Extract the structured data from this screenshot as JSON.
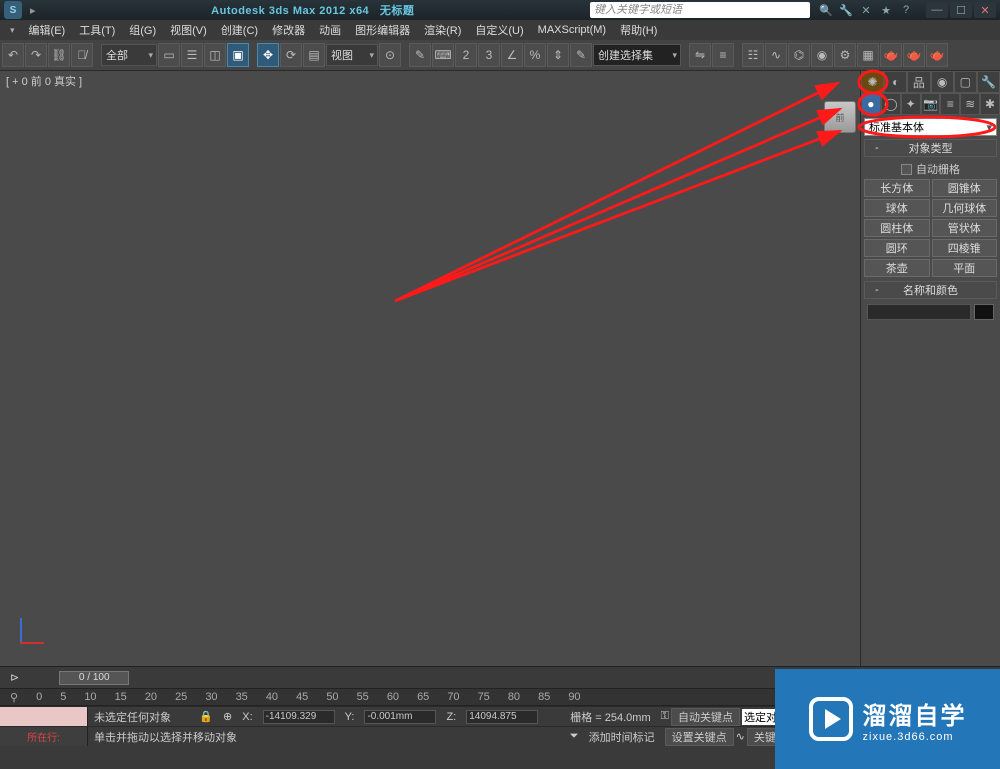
{
  "title": {
    "app": "Autodesk 3ds Max  2012  x64",
    "doc": "无标题",
    "search_placeholder": "键入关键字或短语",
    "app_icon": "S"
  },
  "menu": [
    "编辑(E)",
    "工具(T)",
    "组(G)",
    "视图(V)",
    "创建(C)",
    "修改器",
    "动画",
    "图形编辑器",
    "渲染(R)",
    "自定义(U)",
    "MAXScript(M)",
    "帮助(H)"
  ],
  "toolbar": {
    "filter_all": "全部",
    "view_label": "视图",
    "named_set_empty": "创建选择集"
  },
  "viewport": {
    "label": "[ + 0 前 0 真实 ]",
    "cube": "前"
  },
  "cmd": {
    "category": "标准基本体",
    "rollout_type": "对象类型",
    "autogrid": "自动栅格",
    "buttons": [
      [
        "长方体",
        "圆锥体"
      ],
      [
        "球体",
        "几何球体"
      ],
      [
        "圆柱体",
        "管状体"
      ],
      [
        "圆环",
        "四棱锥"
      ],
      [
        "茶壶",
        "平面"
      ]
    ],
    "rollout_name": "名称和颜色"
  },
  "time": {
    "range": "0 / 100",
    "ticks": [
      "0",
      "5",
      "10",
      "15",
      "20",
      "25",
      "30",
      "35",
      "40",
      "45",
      "50",
      "55",
      "60",
      "65",
      "70",
      "75",
      "80",
      "85",
      "90"
    ]
  },
  "status": {
    "none_selected": "未选定任何对象",
    "prompt": "单击并拖动以选择并移动对象",
    "x": "-14109.329",
    "y": "-0.001mm",
    "z": "14094.875",
    "grid": "栅格 = 254.0mm",
    "add_time_tag": "添加时间标记",
    "autokey": "自动关键点",
    "selset": "选定对象",
    "setkey": "设置关键点",
    "keyfilter": "关键点过滤器...",
    "now_row": "所在行:"
  },
  "watermark": {
    "big": "溜溜自学",
    "small": "zixue.3d66.com"
  }
}
